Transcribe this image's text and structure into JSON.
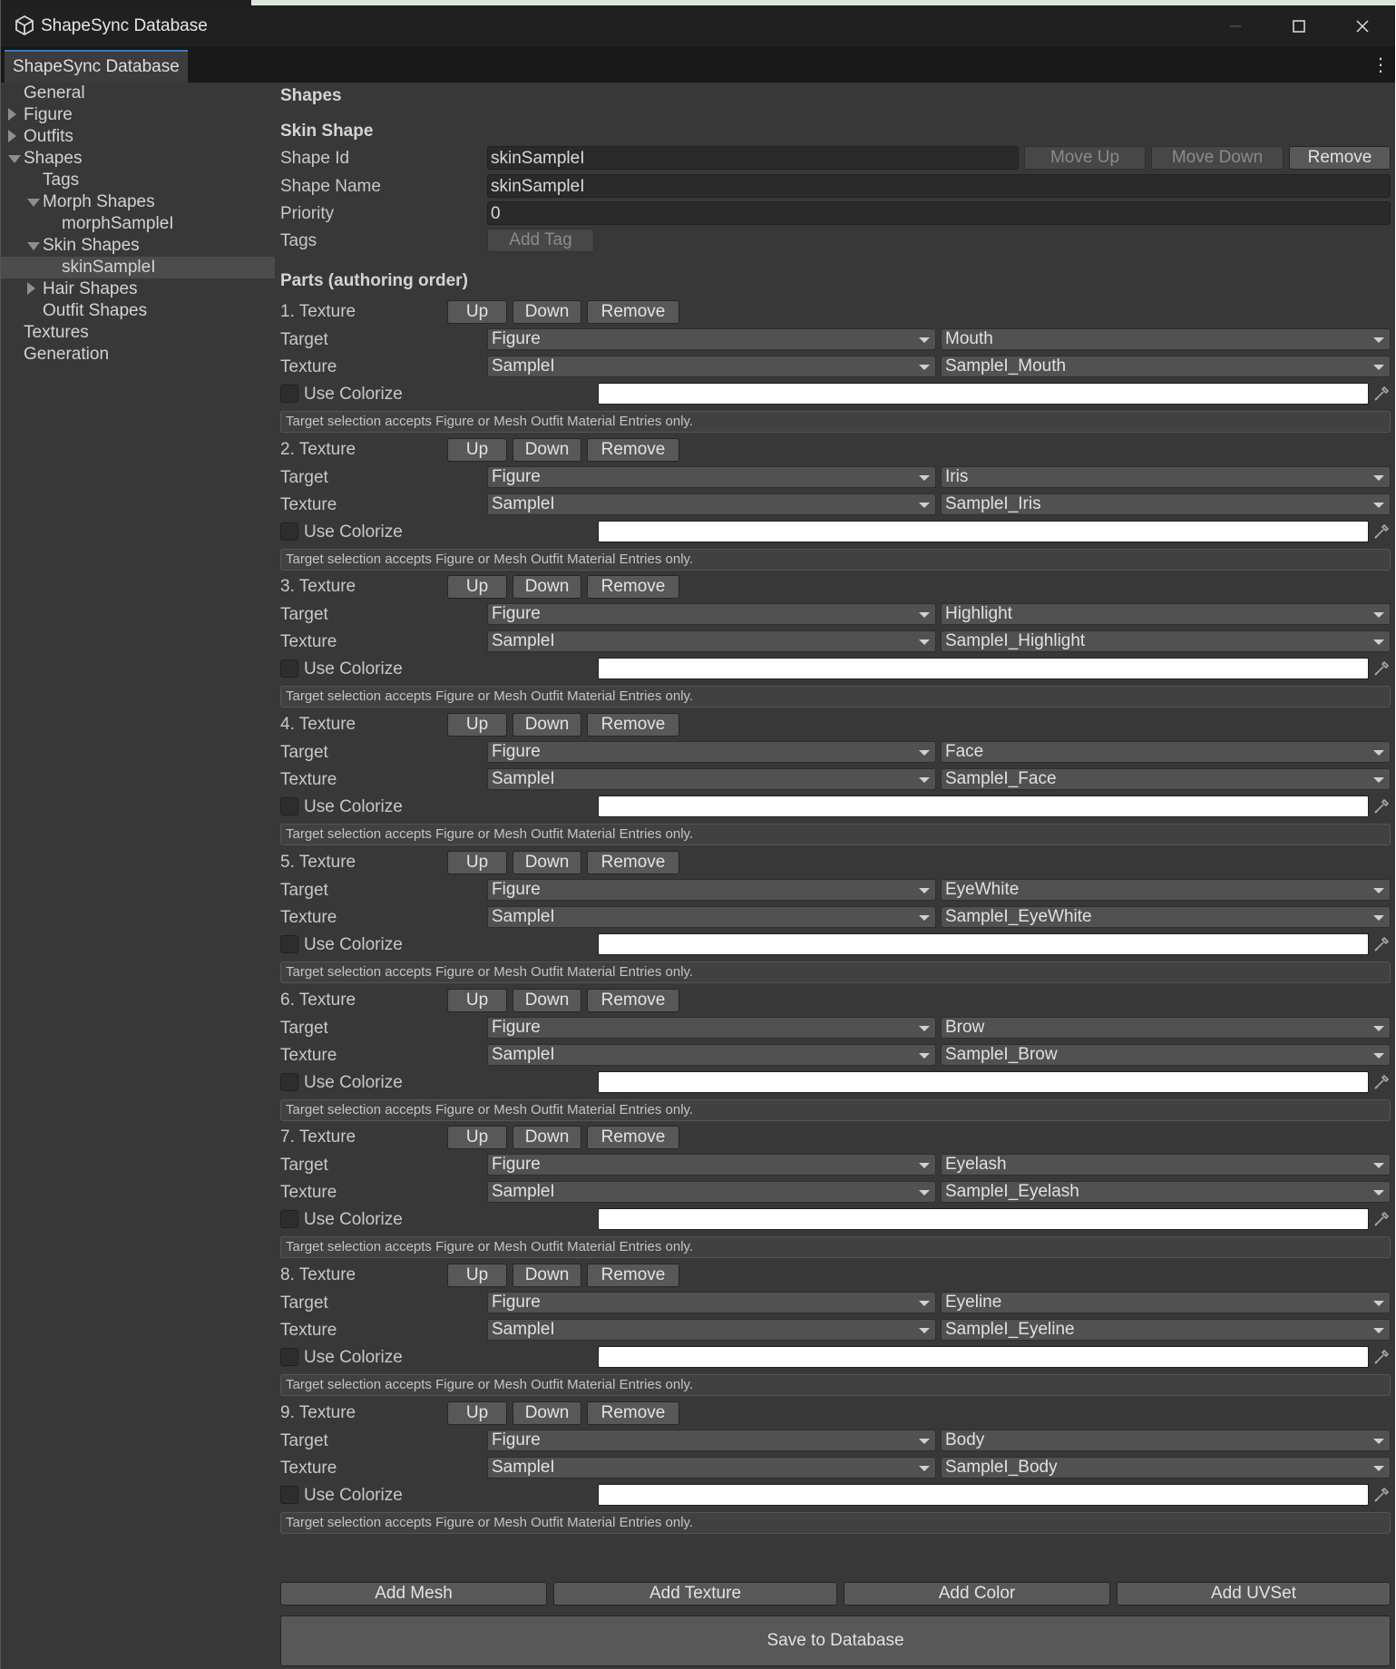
{
  "window": {
    "title": "ShapeSync Database"
  },
  "tab": {
    "label": "ShapeSync Database"
  },
  "sidebar": {
    "items": [
      {
        "label": "General",
        "indent": 0,
        "arrow": "none"
      },
      {
        "label": "Figure",
        "indent": 0,
        "arrow": "right"
      },
      {
        "label": "Outfits",
        "indent": 0,
        "arrow": "right"
      },
      {
        "label": "Shapes",
        "indent": 0,
        "arrow": "down"
      },
      {
        "label": "Tags",
        "indent": 1,
        "arrow": "none"
      },
      {
        "label": "Morph Shapes",
        "indent": 1,
        "arrow": "down"
      },
      {
        "label": "morphSampleI",
        "indent": 2,
        "arrow": "none"
      },
      {
        "label": "Skin Shapes",
        "indent": 1,
        "arrow": "down"
      },
      {
        "label": "skinSampleI",
        "indent": 2,
        "arrow": "none",
        "selected": true
      },
      {
        "label": "Hair Shapes",
        "indent": 1,
        "arrow": "right"
      },
      {
        "label": "Outfit Shapes",
        "indent": 1,
        "arrow": "none"
      },
      {
        "label": "Textures",
        "indent": 0,
        "arrow": "none"
      },
      {
        "label": "Generation",
        "indent": 0,
        "arrow": "none"
      }
    ]
  },
  "main": {
    "section_title": "Shapes",
    "subsection_title": "Skin Shape",
    "shape_id": {
      "label": "Shape Id",
      "value": "skinSampleI"
    },
    "shape_name": {
      "label": "Shape Name",
      "value": "skinSampleI"
    },
    "priority": {
      "label": "Priority",
      "value": "0"
    },
    "tags": {
      "label": "Tags",
      "add_label": "Add Tag"
    },
    "buttons": {
      "move_up": "Move Up",
      "move_down": "Move Down",
      "remove": "Remove"
    },
    "parts_title": "Parts (authoring order)",
    "part_labels": {
      "up": "Up",
      "down": "Down",
      "remove": "Remove",
      "target": "Target",
      "texture": "Texture",
      "use_colorize": "Use Colorize",
      "help": "Target selection accepts Figure or Mesh Outfit Material Entries only."
    },
    "parts": [
      {
        "title": "1. Texture",
        "target_source": "Figure",
        "target_entry": "Mouth",
        "texture_source": "SampleI",
        "texture_entry": "SampleI_Mouth",
        "use_colorize": false
      },
      {
        "title": "2. Texture",
        "target_source": "Figure",
        "target_entry": "Iris",
        "texture_source": "SampleI",
        "texture_entry": "SampleI_Iris",
        "use_colorize": false
      },
      {
        "title": "3. Texture",
        "target_source": "Figure",
        "target_entry": "Highlight",
        "texture_source": "SampleI",
        "texture_entry": "SampleI_Highlight",
        "use_colorize": false
      },
      {
        "title": "4. Texture",
        "target_source": "Figure",
        "target_entry": "Face",
        "texture_source": "SampleI",
        "texture_entry": "SampleI_Face",
        "use_colorize": false
      },
      {
        "title": "5. Texture",
        "target_source": "Figure",
        "target_entry": "EyeWhite",
        "texture_source": "SampleI",
        "texture_entry": "SampleI_EyeWhite",
        "use_colorize": false
      },
      {
        "title": "6. Texture",
        "target_source": "Figure",
        "target_entry": "Brow",
        "texture_source": "SampleI",
        "texture_entry": "SampleI_Brow",
        "use_colorize": false
      },
      {
        "title": "7. Texture",
        "target_source": "Figure",
        "target_entry": "Eyelash",
        "texture_source": "SampleI",
        "texture_entry": "SampleI_Eyelash",
        "use_colorize": false
      },
      {
        "title": "8. Texture",
        "target_source": "Figure",
        "target_entry": "Eyeline",
        "texture_source": "SampleI",
        "texture_entry": "SampleI_Eyeline",
        "use_colorize": false
      },
      {
        "title": "9. Texture",
        "target_source": "Figure",
        "target_entry": "Body",
        "texture_source": "SampleI",
        "texture_entry": "SampleI_Body",
        "use_colorize": false
      }
    ],
    "add_buttons": {
      "mesh": "Add Mesh",
      "texture": "Add Texture",
      "color": "Add Color",
      "uvset": "Add UVSet"
    },
    "save_button": "Save to Database"
  },
  "colors": {
    "background": "#383838",
    "titlebar": "#202020",
    "tab_accent": "#3a79bb",
    "field": "#2a2a2a",
    "button": "#585858",
    "color_swatch": "#ffffff"
  }
}
